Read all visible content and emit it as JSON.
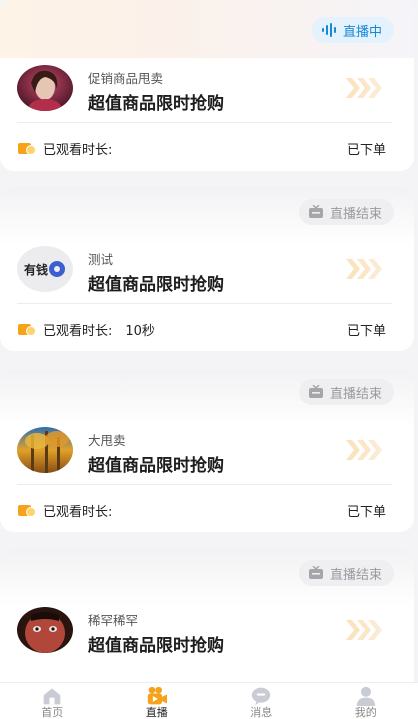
{
  "colors": {
    "live_badge_text": "#1787d6",
    "live_badge_bg": "#e3f2fc",
    "ended_badge_text": "#9a9a9e",
    "accent_orange": "#f7a21b"
  },
  "cards": [
    {
      "status": "直播中",
      "status_type": "live",
      "avatar_icon": "avatar-woman-portrait",
      "host": "促销商品甩卖",
      "title": "超值商品限时抢购",
      "watch_label": "已观看时长:",
      "watch_value": "",
      "order_status": "已下单"
    },
    {
      "status": "直播结束",
      "status_type": "ended",
      "avatar_icon": "avatar-logo-gear",
      "avatar_text": "有钱",
      "host": "测试",
      "title": "超值商品限时抢购",
      "watch_label": "已观看时长:",
      "watch_value": "10秒",
      "order_status": "已下单"
    },
    {
      "status": "直播结束",
      "status_type": "ended",
      "avatar_icon": "avatar-autumn-forest",
      "host": "大甩卖",
      "title": "超值商品限时抢购",
      "watch_label": "已观看时长:",
      "watch_value": "",
      "order_status": "已下单"
    },
    {
      "status": "直播结束",
      "status_type": "ended",
      "avatar_icon": "avatar-face-closeup",
      "host": "稀罕稀罕",
      "title": "超值商品限时抢购"
    }
  ],
  "tabbar": [
    {
      "label": "首页",
      "icon": "home-icon",
      "active": false
    },
    {
      "label": "直播",
      "icon": "video-camera-icon",
      "active": true
    },
    {
      "label": "消息",
      "icon": "chat-bubble-icon",
      "active": false
    },
    {
      "label": "我的",
      "icon": "user-icon",
      "active": false
    }
  ]
}
